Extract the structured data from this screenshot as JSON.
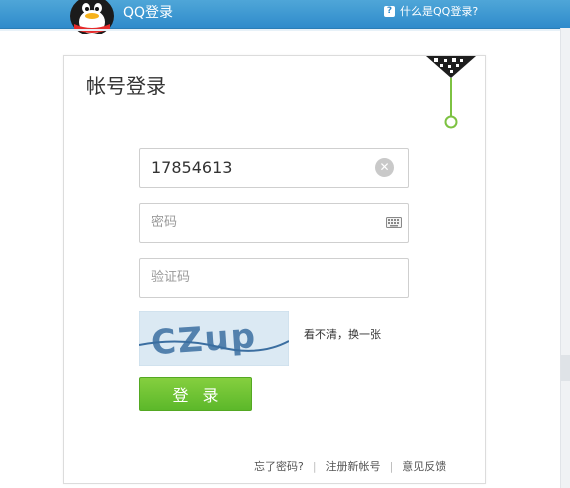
{
  "header": {
    "title": "QQ登录",
    "help_link": "什么是QQ登录?",
    "help_icon": "question-icon",
    "logo_icon": "qq-penguin-icon"
  },
  "login": {
    "title": "帐号登录",
    "qr_icon": "qr-code-icon",
    "account_value": "17854613",
    "password_placeholder": "密码",
    "captcha_placeholder": "验证码",
    "captcha_text": "CZup",
    "refresh_label": "看不清，换一张",
    "login_button": "登录"
  },
  "footer": {
    "forgot_password": "忘了密码?",
    "register": "注册新帐号",
    "feedback": "意见反馈"
  },
  "colors": {
    "header_blue": "#2f8bcb",
    "button_green": "#6dc33a",
    "qr_green": "#7dc242"
  }
}
